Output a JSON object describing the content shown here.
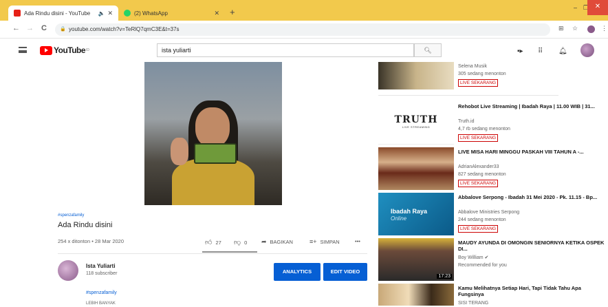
{
  "browser": {
    "tabs": [
      {
        "title": "Ada Rindu disini - YouTube",
        "active": true,
        "favicon_color": "#e62117",
        "has_audio": true
      },
      {
        "title": "(2) WhatsApp",
        "active": false,
        "favicon_color": "#25d366"
      }
    ],
    "new_tab": "+",
    "minimize": "–",
    "maximize": "❐",
    "close": "✕",
    "back": "←",
    "forward": "→",
    "reload": "C",
    "url": "youtube.com/watch?v=TeRlQ7qmC3E&t=37s",
    "tabbar_color": "#f2c94c"
  },
  "youtube": {
    "logo_text": "YouTube",
    "logo_sup": "ID",
    "search_value": "ista yuliarti",
    "search_icon": "search-icon",
    "header_icons": [
      "create-video-icon",
      "apps-grid-icon",
      "notifications-bell-icon"
    ]
  },
  "video": {
    "hashtag": "#spenzafamily",
    "title": "Ada Rindu disini",
    "meta": "254 x ditonton • 28 Mar 2020",
    "likes": "27",
    "dislikes": "0",
    "share_label": "BAGIKAN",
    "save_label": "SIMPAN",
    "more": "•••"
  },
  "channel": {
    "name": "Ista Yuliarti",
    "subscribers": "118 subscriber",
    "analytics_label": "ANALYTICS",
    "edit_label": "EDIT VIDEO",
    "description_tag": "#spenzafamily",
    "show_more": "LEBIH BANYAK"
  },
  "sidebar": {
    "items": [
      {
        "title": "",
        "channel": "Selena Musik",
        "views": "305 sedang menonton",
        "live": "LIVE SEKARANG",
        "thumb": "music"
      },
      {
        "title": "Rehobot Live Streaming | Ibadah Raya | 11.00 WIB | 31...",
        "channel": "Truth.id",
        "views": "4,7 rb sedang menonton",
        "live": "LIVE SEKARANG",
        "thumb": "truth",
        "thumb_text": "TRUTH",
        "thumb_sub": "LIVE STREAMING"
      },
      {
        "title": "LIVE MISA HARI MINGGU PASKAH VIII TAHUN A -...",
        "channel": "AdrianAlexander33",
        "views": "827 sedang menonton",
        "live": "LIVE SEKARANG",
        "thumb": "church"
      },
      {
        "title": "Abbalove Serpong - Ibadah 31 Mei 2020 - Pk. 11.15 - Bp...",
        "channel": "Abbalove Ministries Serpong",
        "views": "244 sedang menonton",
        "live": "LIVE SEKARANG",
        "thumb": "abbalove",
        "thumb_text": "Ibadah Raya",
        "thumb_sub": "Online"
      },
      {
        "title": "MAUDY AYUNDA DI OMONGIN SENIORNYA KETIKA OSPEK DI...",
        "channel": "Boy William ✔",
        "views": "Recommended for you",
        "live": "",
        "thumb": "maudy",
        "duration": "17:23"
      },
      {
        "title": "Kamu Melihatnya Setiap Hari, Tapi Tidak Tahu Apa Fungsinya",
        "channel": "SISI TERANG",
        "views": "",
        "live": "",
        "thumb": "sticks"
      }
    ]
  }
}
